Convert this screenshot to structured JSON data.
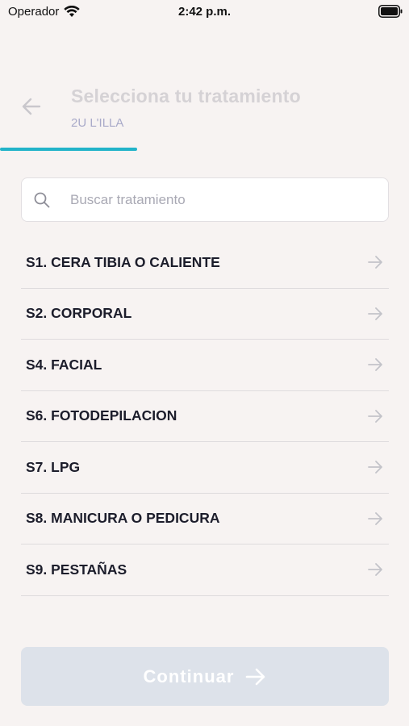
{
  "status_bar": {
    "carrier": "Operador",
    "time": "2:42 p.m."
  },
  "header": {
    "title": "Selecciona tu tratamiento",
    "subtitle": "2U L'ILLA",
    "progress_fraction": 0.335
  },
  "search": {
    "placeholder": "Buscar tratamiento",
    "value": ""
  },
  "treatments": [
    {
      "label": "S1. CERA TIBIA O CALIENTE"
    },
    {
      "label": "S2. CORPORAL"
    },
    {
      "label": "S4. FACIAL"
    },
    {
      "label": "S6. FOTODEPILACION"
    },
    {
      "label": "S7. LPG"
    },
    {
      "label": "S8. MANICURA O PEDICURA"
    },
    {
      "label": "S9. PESTAÑAS"
    }
  ],
  "footer": {
    "continue_label": "Continuar"
  },
  "colors": {
    "accent": "#22b3c9",
    "background": "#f7f3f2",
    "disabled_button": "#dde2ea"
  },
  "icons": [
    "wifi-icon",
    "battery-icon",
    "back-arrow-icon",
    "search-icon",
    "chevron-right-icon",
    "arrow-right-icon"
  ]
}
